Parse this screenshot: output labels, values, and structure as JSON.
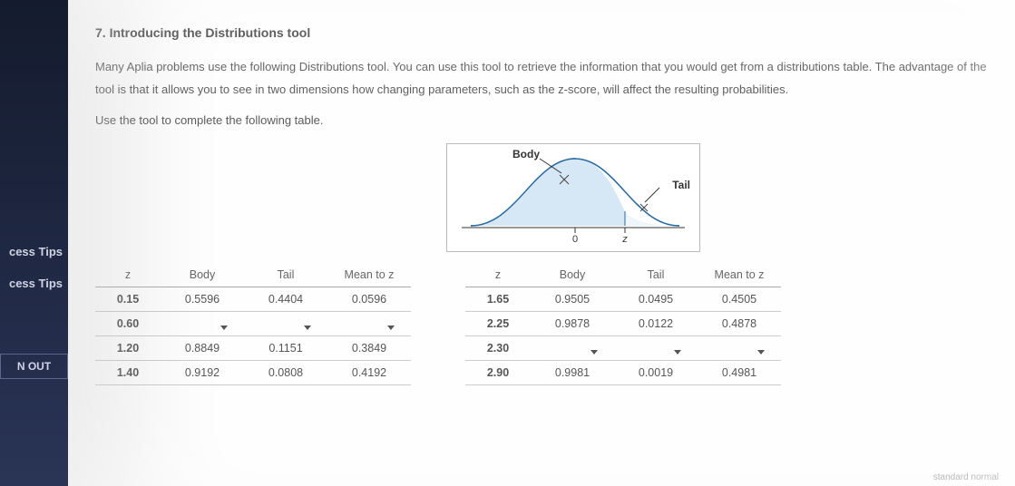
{
  "sidebar": {
    "items": [
      {
        "label": "cess Tips"
      },
      {
        "label": "cess Tips"
      }
    ],
    "out": "N OUT"
  },
  "heading": "7. Introducing the Distributions tool",
  "paragraph": "Many Aplia problems use the following Distributions tool. You can use this tool to retrieve the information that you would get from a distributions table. The advantage of the tool is that it allows you to see in two dimensions how changing parameters, such as the z-score, will affect the resulting probabilities.",
  "instruction": "Use the tool to complete the following table.",
  "figure": {
    "body_label": "Body",
    "tail_label": "Tail",
    "axis_zero": "0",
    "axis_z": "z"
  },
  "headers": {
    "z": "z",
    "body": "Body",
    "tail": "Tail",
    "mean_to_z": "Mean to z"
  },
  "left_rows": [
    {
      "z": "0.15",
      "body": "0.5596",
      "tail": "0.4404",
      "m2z": "0.0596",
      "dd": false
    },
    {
      "z": "0.60",
      "body": "",
      "tail": "",
      "m2z": "",
      "dd": true
    },
    {
      "z": "1.20",
      "body": "0.8849",
      "tail": "0.1151",
      "m2z": "0.3849",
      "dd": false
    },
    {
      "z": "1.40",
      "body": "0.9192",
      "tail": "0.0808",
      "m2z": "0.4192",
      "dd": false
    }
  ],
  "right_rows": [
    {
      "z": "1.65",
      "body": "0.9505",
      "tail": "0.0495",
      "m2z": "0.4505",
      "dd": false
    },
    {
      "z": "2.25",
      "body": "0.9878",
      "tail": "0.0122",
      "m2z": "0.4878",
      "dd": false
    },
    {
      "z": "2.30",
      "body": "",
      "tail": "",
      "m2z": "",
      "dd": true
    },
    {
      "z": "2.90",
      "body": "0.9981",
      "tail": "0.0019",
      "m2z": "0.4981",
      "dd": false
    }
  ],
  "footer_hint": "standard normal"
}
